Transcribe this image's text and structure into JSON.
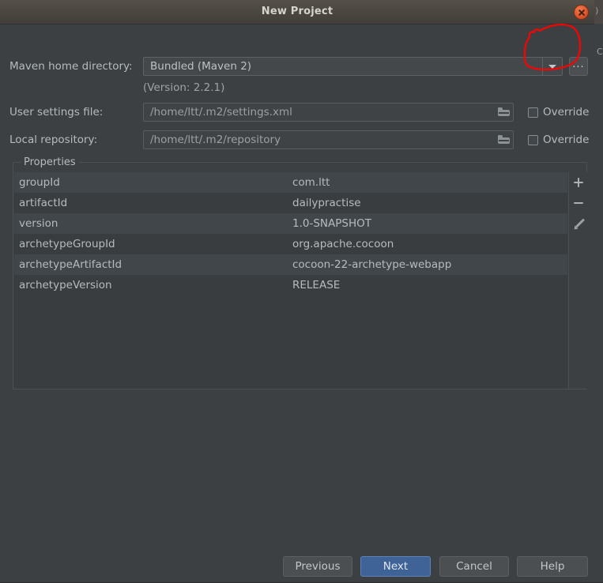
{
  "window": {
    "title": "New Project",
    "close_icon": "close-icon"
  },
  "form": {
    "maven_home": {
      "label": "Maven home directory:",
      "value": "Bundled (Maven 2)",
      "dropdown_icon": "chevron-down-icon",
      "browse_label": "...",
      "version_note": "(Version: 2.2.1)"
    },
    "user_settings": {
      "label": "User settings file:",
      "value": "/home/ltt/.m2/settings.xml",
      "folder_icon": "folder-icon",
      "override_label": "Override",
      "override_checked": false
    },
    "local_repository": {
      "label": "Local repository:",
      "value": "/home/ltt/.m2/repository",
      "folder_icon": "folder-icon",
      "override_label": "Override",
      "override_checked": false
    }
  },
  "properties": {
    "title": "Properties",
    "rows": [
      {
        "key": "groupId",
        "value": "com.ltt"
      },
      {
        "key": "artifactId",
        "value": "dailypractise"
      },
      {
        "key": "version",
        "value": "1.0-SNAPSHOT"
      },
      {
        "key": "archetypeGroupId",
        "value": "org.apache.cocoon"
      },
      {
        "key": "archetypeArtifactId",
        "value": "cocoon-22-archetype-webapp"
      },
      {
        "key": "archetypeVersion",
        "value": "RELEASE"
      }
    ],
    "toolbar": {
      "add_icon": "plus-icon",
      "remove_icon": "minus-icon",
      "edit_icon": "pencil-icon"
    }
  },
  "footer": {
    "previous_label": "Previous",
    "next_label": "Next",
    "cancel_label": "Cancel",
    "help_label": "Help"
  },
  "annotation": {
    "shape": "hand-drawn-circle",
    "color": "#ff0000",
    "target": "maven-home-dropdown-arrow"
  },
  "colors": {
    "dialog_bg": "#3c4043",
    "titlebar": "#4b4741",
    "accent_blue": "#3f6396",
    "close_button": "#e2562c",
    "text": "#b6bbbd"
  },
  "background_window": {
    "edge_glyph_top": ")",
    "edge_glyph_mid": "C"
  }
}
